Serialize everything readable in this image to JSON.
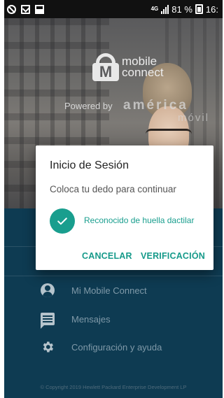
{
  "status_bar": {
    "network": "4G",
    "battery_percent": "81 %",
    "time": "16:"
  },
  "hero": {
    "logo_text_line1": "mobile",
    "logo_text_line2": "connect",
    "logo_mark": "M",
    "powered_by": "Powered by",
    "partner_line1": "américa",
    "partner_line2": "móvil"
  },
  "menu": {
    "items": [
      {
        "label": "Mi Mobile Connect",
        "icon": "account-icon"
      },
      {
        "label": "Mensajes",
        "icon": "message-icon"
      },
      {
        "label": "Configuración y ayuda",
        "icon": "gear-icon"
      }
    ],
    "copyright": "© Copyright 2019 Hewlett Packard Enterprise Development LP"
  },
  "dialog": {
    "title": "Inicio de Sesión",
    "message": "Coloca tu dedo para continuar",
    "status": "Reconocido de huella dactilar",
    "cancel_label": "CANCELAR",
    "verify_label": "VERIFICACIÓN",
    "accent_color": "#199e8e"
  },
  "colors": {
    "menu_background": "#0e3b52",
    "menu_text": "#7f99a8"
  }
}
